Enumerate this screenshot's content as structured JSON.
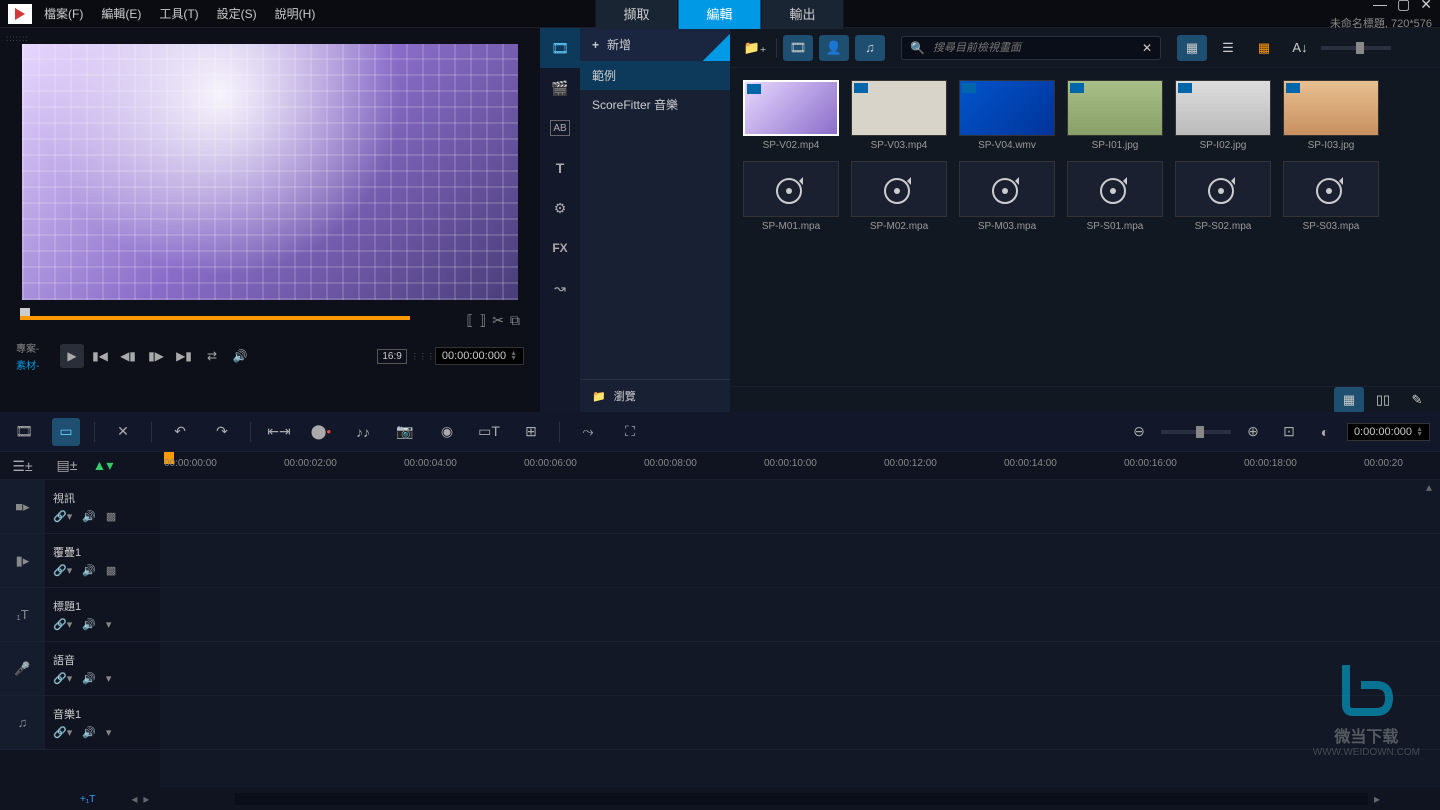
{
  "menu": {
    "file": "檔案(F)",
    "edit": "編輯(E)",
    "tools": "工具(T)",
    "settings": "設定(S)",
    "help": "說明(H)"
  },
  "tabs": {
    "capture": "擷取",
    "edit": "編輯",
    "output": "輸出"
  },
  "status": "未命名標題, 720*576",
  "preview": {
    "project": "專案-",
    "clip": "素材-",
    "aspect": "16:9",
    "timecode": "00:00:00:000"
  },
  "library": {
    "add": "新增",
    "items": {
      "sample": "範例",
      "scorefitter": "ScoreFitter 音樂"
    },
    "browse": "瀏覽",
    "search_ph": "搜尋目前檢視畫面",
    "clips": [
      {
        "name": "SP-V02.mp4",
        "type": "video",
        "bg": "linear-gradient(135deg,#e8d8ff,#8a6dc9)",
        "sel": true
      },
      {
        "name": "SP-V03.mp4",
        "type": "video",
        "bg": "#d9d4c9"
      },
      {
        "name": "SP-V04.wmv",
        "type": "video",
        "bg": "linear-gradient(135deg,#0055cc,#003399)"
      },
      {
        "name": "SP-I01.jpg",
        "type": "image",
        "bg": "linear-gradient(#a8c088,#88a068)"
      },
      {
        "name": "SP-I02.jpg",
        "type": "image",
        "bg": "linear-gradient(#ddd,#bbb)"
      },
      {
        "name": "SP-I03.jpg",
        "type": "image",
        "bg": "linear-gradient(#e8c090,#c89060)"
      },
      {
        "name": "SP-M01.mpa",
        "type": "audio"
      },
      {
        "name": "SP-M02.mpa",
        "type": "audio"
      },
      {
        "name": "SP-M03.mpa",
        "type": "audio"
      },
      {
        "name": "SP-S01.mpa",
        "type": "audio"
      },
      {
        "name": "SP-S02.mpa",
        "type": "audio"
      },
      {
        "name": "SP-S03.mpa",
        "type": "audio"
      }
    ]
  },
  "timeline": {
    "timecode": "0:00:00:000",
    "ruler": [
      "00:00:00:00",
      "00:00:02:00",
      "00:00:04:00",
      "00:00:06:00",
      "00:00:08:00",
      "00:00:10:00",
      "00:00:12:00",
      "00:00:14:00",
      "00:00:16:00",
      "00:00:18:00",
      "00:00:20"
    ],
    "tracks": [
      {
        "name": "視訊",
        "icon": "■▸"
      },
      {
        "name": "覆疊1",
        "icon": "▮▸"
      },
      {
        "name": "標題1",
        "icon": "₁T"
      },
      {
        "name": "語音",
        "icon": "🎤"
      },
      {
        "name": "音樂1",
        "icon": "♫"
      }
    ],
    "add_track": "+₁T"
  },
  "watermark": {
    "brand": "微当下载",
    "url": "WWW.WEIDOWN.COM"
  }
}
